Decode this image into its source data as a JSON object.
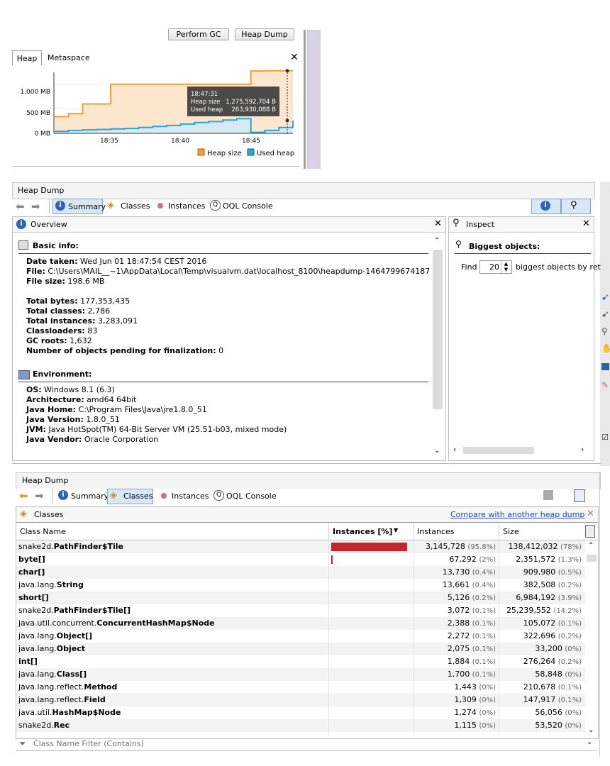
{
  "monitor": {
    "buttons": [
      "Perform GC",
      "Heap Dump"
    ],
    "tabs": [
      "Heap",
      "Metaspace"
    ],
    "chart": {
      "y_ticks": [
        "1,000 MB",
        "500 MB",
        "0 MB"
      ],
      "x_ticks": [
        "18:35",
        "18:40",
        "18:45"
      ],
      "tooltip_time": "18:47:31",
      "tooltip_heap_label": "Heap size",
      "tooltip_heap_value": "1,275,592,704 B",
      "tooltip_used_label": "Used heap",
      "tooltip_used_value": "263,930,088 B",
      "legend": [
        "Heap size",
        "Used heap"
      ],
      "colors": {
        "heap": "#f0a030",
        "used": "#2aa6d6"
      }
    }
  },
  "chart_data": {
    "type": "area",
    "x_unit": "time (minutes past 18:30)",
    "x": [
      1,
      2,
      3,
      4,
      5,
      6,
      7,
      8,
      9,
      10,
      11,
      12,
      13,
      14,
      15,
      16,
      17,
      18
    ],
    "series": [
      {
        "name": "Heap size",
        "values": [
          340,
          400,
          600,
          600,
          1000,
          1000,
          1000,
          1000,
          1000,
          1000,
          1000,
          1000,
          1000,
          1000,
          1270,
          1275,
          1275,
          1275
        ]
      },
      {
        "name": "Used heap",
        "values": [
          40,
          60,
          70,
          80,
          90,
          100,
          120,
          140,
          160,
          190,
          220,
          240,
          270,
          300,
          20,
          60,
          120,
          260
        ]
      }
    ],
    "ylim": [
      0,
      1300
    ]
  },
  "heapdump1": {
    "title": "Heap Dump",
    "toolbar": {
      "summary": "Summary",
      "classes": "Classes",
      "instances": "Instances",
      "oql": "OQL Console"
    },
    "overview_title": "Overview",
    "basic_info_title": "Basic info:",
    "basic": [
      {
        "label": "Date taken:",
        "value": " Wed Jun 01 18:47:54 CEST 2016"
      },
      {
        "label": "File:",
        "value": " C:\\Users\\MAIL__~1\\AppData\\Local\\Temp\\visualvm.dat\\localhost_8100\\heapdump-1464799674187.hprof"
      },
      {
        "label": "File size:",
        "value": " 198.6 MB"
      }
    ],
    "stats": [
      {
        "label": "Total bytes:",
        "value": " 177,353,435"
      },
      {
        "label": "Total classes:",
        "value": " 2,786"
      },
      {
        "label": "Total instances:",
        "value": " 3,283,091"
      },
      {
        "label": "Classloaders:",
        "value": " 83"
      },
      {
        "label": "GC roots:",
        "value": " 1,632"
      },
      {
        "label": "Number of objects pending for finalization:",
        "value": " 0"
      }
    ],
    "env_title": "Environment:",
    "env": [
      {
        "label": "OS:",
        "value": " Windows 8.1 (6.3)"
      },
      {
        "label": "Architecture:",
        "value": " amd64 64bit"
      },
      {
        "label": "Java Home:",
        "value": " C:\\Program Files\\Java\\jre1.8.0_51"
      },
      {
        "label": "Java Version:",
        "value": " 1.8.0_51"
      },
      {
        "label": "JVM:",
        "value": " Java HotSpot(TM) 64-Bit Server VM (25.51-b03, mixed mode)"
      },
      {
        "label": "Java Vendor:",
        "value": " Oracle Corporation"
      }
    ],
    "inspect_title": "Inspect",
    "biggest_title": "Biggest objects:",
    "find_label": "Find",
    "find_value": "20",
    "find_suffix": "biggest objects by ret"
  },
  "heapdump2": {
    "title": "Heap Dump",
    "toolbar": {
      "summary": "Summary",
      "classes": "Classes",
      "instances": "Instances",
      "oql": "OQL Console"
    },
    "panel_title": "Classes",
    "compare_link": "Compare with another heap dump",
    "columns": [
      "Class Name",
      "Instances [%]",
      "Instances",
      "Size"
    ],
    "rows": [
      {
        "pre": "snake2d.",
        "bold": "PathFinder$Tile",
        "fill": 0.958,
        "inst": "3,145,728",
        "ipct": "(95.8%)",
        "size": "138,412,032",
        "spct": "(78%)"
      },
      {
        "pre": "",
        "bold": "byte[]",
        "fill": 0.02,
        "inst": "67,292",
        "ipct": "(2%)",
        "size": "2,351,572",
        "spct": "(1.3%)"
      },
      {
        "pre": "",
        "bold": "char[]",
        "fill": 0.004,
        "inst": "13,730",
        "ipct": "(0.4%)",
        "size": "909,980",
        "spct": "(0.5%)"
      },
      {
        "pre": "java.lang.",
        "bold": "String",
        "fill": 0.004,
        "inst": "13,661",
        "ipct": "(0.4%)",
        "size": "382,508",
        "spct": "(0.2%)"
      },
      {
        "pre": "",
        "bold": "short[]",
        "fill": 0.002,
        "inst": "5,126",
        "ipct": "(0.2%)",
        "size": "6,984,192",
        "spct": "(3.9%)"
      },
      {
        "pre": "snake2d.",
        "bold": "PathFinder$Tile[]",
        "fill": 0.001,
        "inst": "3,072",
        "ipct": "(0.1%)",
        "size": "25,239,552",
        "spct": "(14.2%)"
      },
      {
        "pre": "java.util.concurrent.",
        "bold": "ConcurrentHashMap$Node",
        "fill": 0.001,
        "inst": "2,388",
        "ipct": "(0.1%)",
        "size": "105,072",
        "spct": "(0.1%)"
      },
      {
        "pre": "java.lang.",
        "bold": "Object[]",
        "fill": 0.001,
        "inst": "2,272",
        "ipct": "(0.1%)",
        "size": "322,696",
        "spct": "(0.2%)"
      },
      {
        "pre": "java.lang.",
        "bold": "Object",
        "fill": 0.001,
        "inst": "2,075",
        "ipct": "(0.1%)",
        "size": "33,200",
        "spct": "(0%)"
      },
      {
        "pre": "",
        "bold": "int[]",
        "fill": 0.001,
        "inst": "1,884",
        "ipct": "(0.1%)",
        "size": "276,264",
        "spct": "(0.2%)"
      },
      {
        "pre": "java.lang.",
        "bold": "Class[]",
        "fill": 0.001,
        "inst": "1,700",
        "ipct": "(0.1%)",
        "size": "58,848",
        "spct": "(0%)"
      },
      {
        "pre": "java.lang.reflect.",
        "bold": "Method",
        "fill": 0,
        "inst": "1,443",
        "ipct": "(0%)",
        "size": "210,678",
        "spct": "(0.1%)"
      },
      {
        "pre": "java.lang.reflect.",
        "bold": "Field",
        "fill": 0,
        "inst": "1,309",
        "ipct": "(0%)",
        "size": "147,917",
        "spct": "(0.1%)"
      },
      {
        "pre": "java.util.",
        "bold": "HashMap$Node",
        "fill": 0,
        "inst": "1,274",
        "ipct": "(0%)",
        "size": "56,056",
        "spct": "(0%)"
      },
      {
        "pre": "snake2d.",
        "bold": "Rec",
        "fill": 0,
        "inst": "1,115",
        "ipct": "(0%)",
        "size": "53,520",
        "spct": "(0%)"
      }
    ],
    "filter_placeholder": "Class Name Filter (Contains)"
  }
}
